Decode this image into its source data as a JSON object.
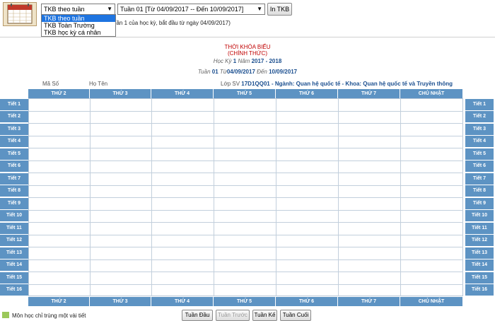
{
  "toolbar": {
    "view_select": "TKB theo tuần",
    "week_select": "Tuần 01 [Từ 04/09/2017 -- Đến 10/09/2017]",
    "print_label": "In TKB",
    "view_options": [
      "TKB theo tuần",
      "TKB Toàn Trường",
      "TKB học kỳ cá nhân"
    ],
    "week_note": "uần 1 của học kỳ, bắt đầu từ ngày 04/09/2017)"
  },
  "header": {
    "title": "THỜI KHÓA BIỂU",
    "subtitle": "(CHÍNH THỨC)",
    "term_label": "Học Kỳ",
    "term_value": "1",
    "year_label": "Năm",
    "year_value": "2017 - 2018",
    "week_label": "Tuần",
    "week_value": "01",
    "from_label": "Từ",
    "from_value": "04/09/2017",
    "to_label": "Đến",
    "to_value": "10/09/2017"
  },
  "student": {
    "id_label": "Mã Số",
    "name_label": "Họ Tên",
    "class_label": "Lớp SV",
    "class_value": "17D1QQ01 - Ngành: Quan hệ quốc tế - Khoa: Quan hệ quốc tế và Truyền thông"
  },
  "days": [
    "THỨ 2",
    "THỨ 3",
    "THỨ 4",
    "THỨ 5",
    "THỨ 6",
    "THỨ 7",
    "CHỦ NHẬT"
  ],
  "periods": [
    "Tiết 1",
    "Tiết 2",
    "Tiết 3",
    "Tiết 4",
    "Tiết 5",
    "Tiết 6",
    "Tiết 7",
    "Tiết 8",
    "Tiết 9",
    "Tiết 10",
    "Tiết 11",
    "Tiết 12",
    "Tiết 13",
    "Tiết 14",
    "Tiết 15",
    "Tiết 16"
  ],
  "legend": {
    "text": "Môn học chỉ trùng một vài tiết",
    "color": "#9bc85a"
  },
  "nav": {
    "first": "Tuần Đầu",
    "prev": "Tuần Trước",
    "next": "Tuần Kế",
    "last": "Tuần Cuối"
  },
  "colors": {
    "header_blue": "#5d93c3",
    "title_red": "#c00000",
    "accent_blue": "#1b4f8f"
  }
}
